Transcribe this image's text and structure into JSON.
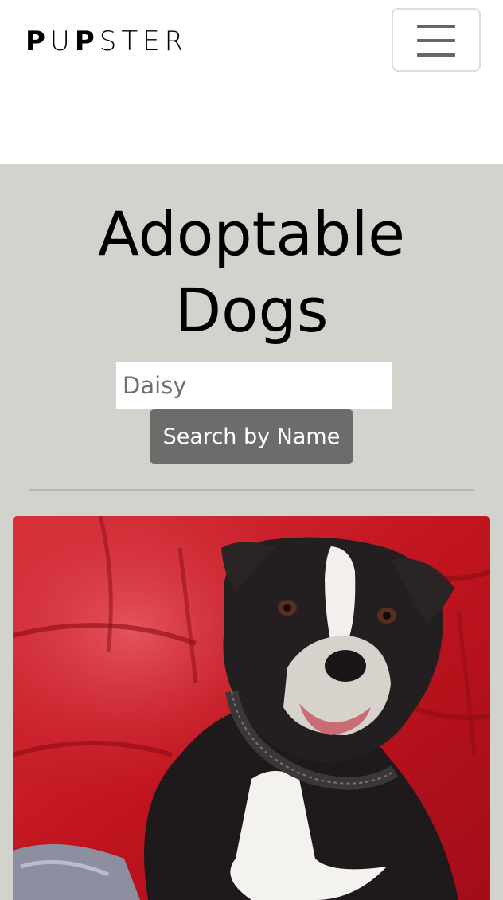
{
  "brand": {
    "logo_letters": [
      "P",
      "U",
      "P",
      "S",
      "T",
      "E",
      "R"
    ]
  },
  "navbar": {
    "menu_toggle_icon": "hamburger-icon"
  },
  "hero": {
    "title_line1": "Adoptable",
    "title_line2": "Dogs",
    "background_color": "#d3d3ce"
  },
  "search": {
    "placeholder": "Daisy",
    "value": "",
    "button_label": "Search by Name",
    "button_color": "#6c6c6a"
  },
  "results": [
    {
      "image": "dog-photo",
      "subject": "black-and-white pit bull on red couch"
    }
  ]
}
